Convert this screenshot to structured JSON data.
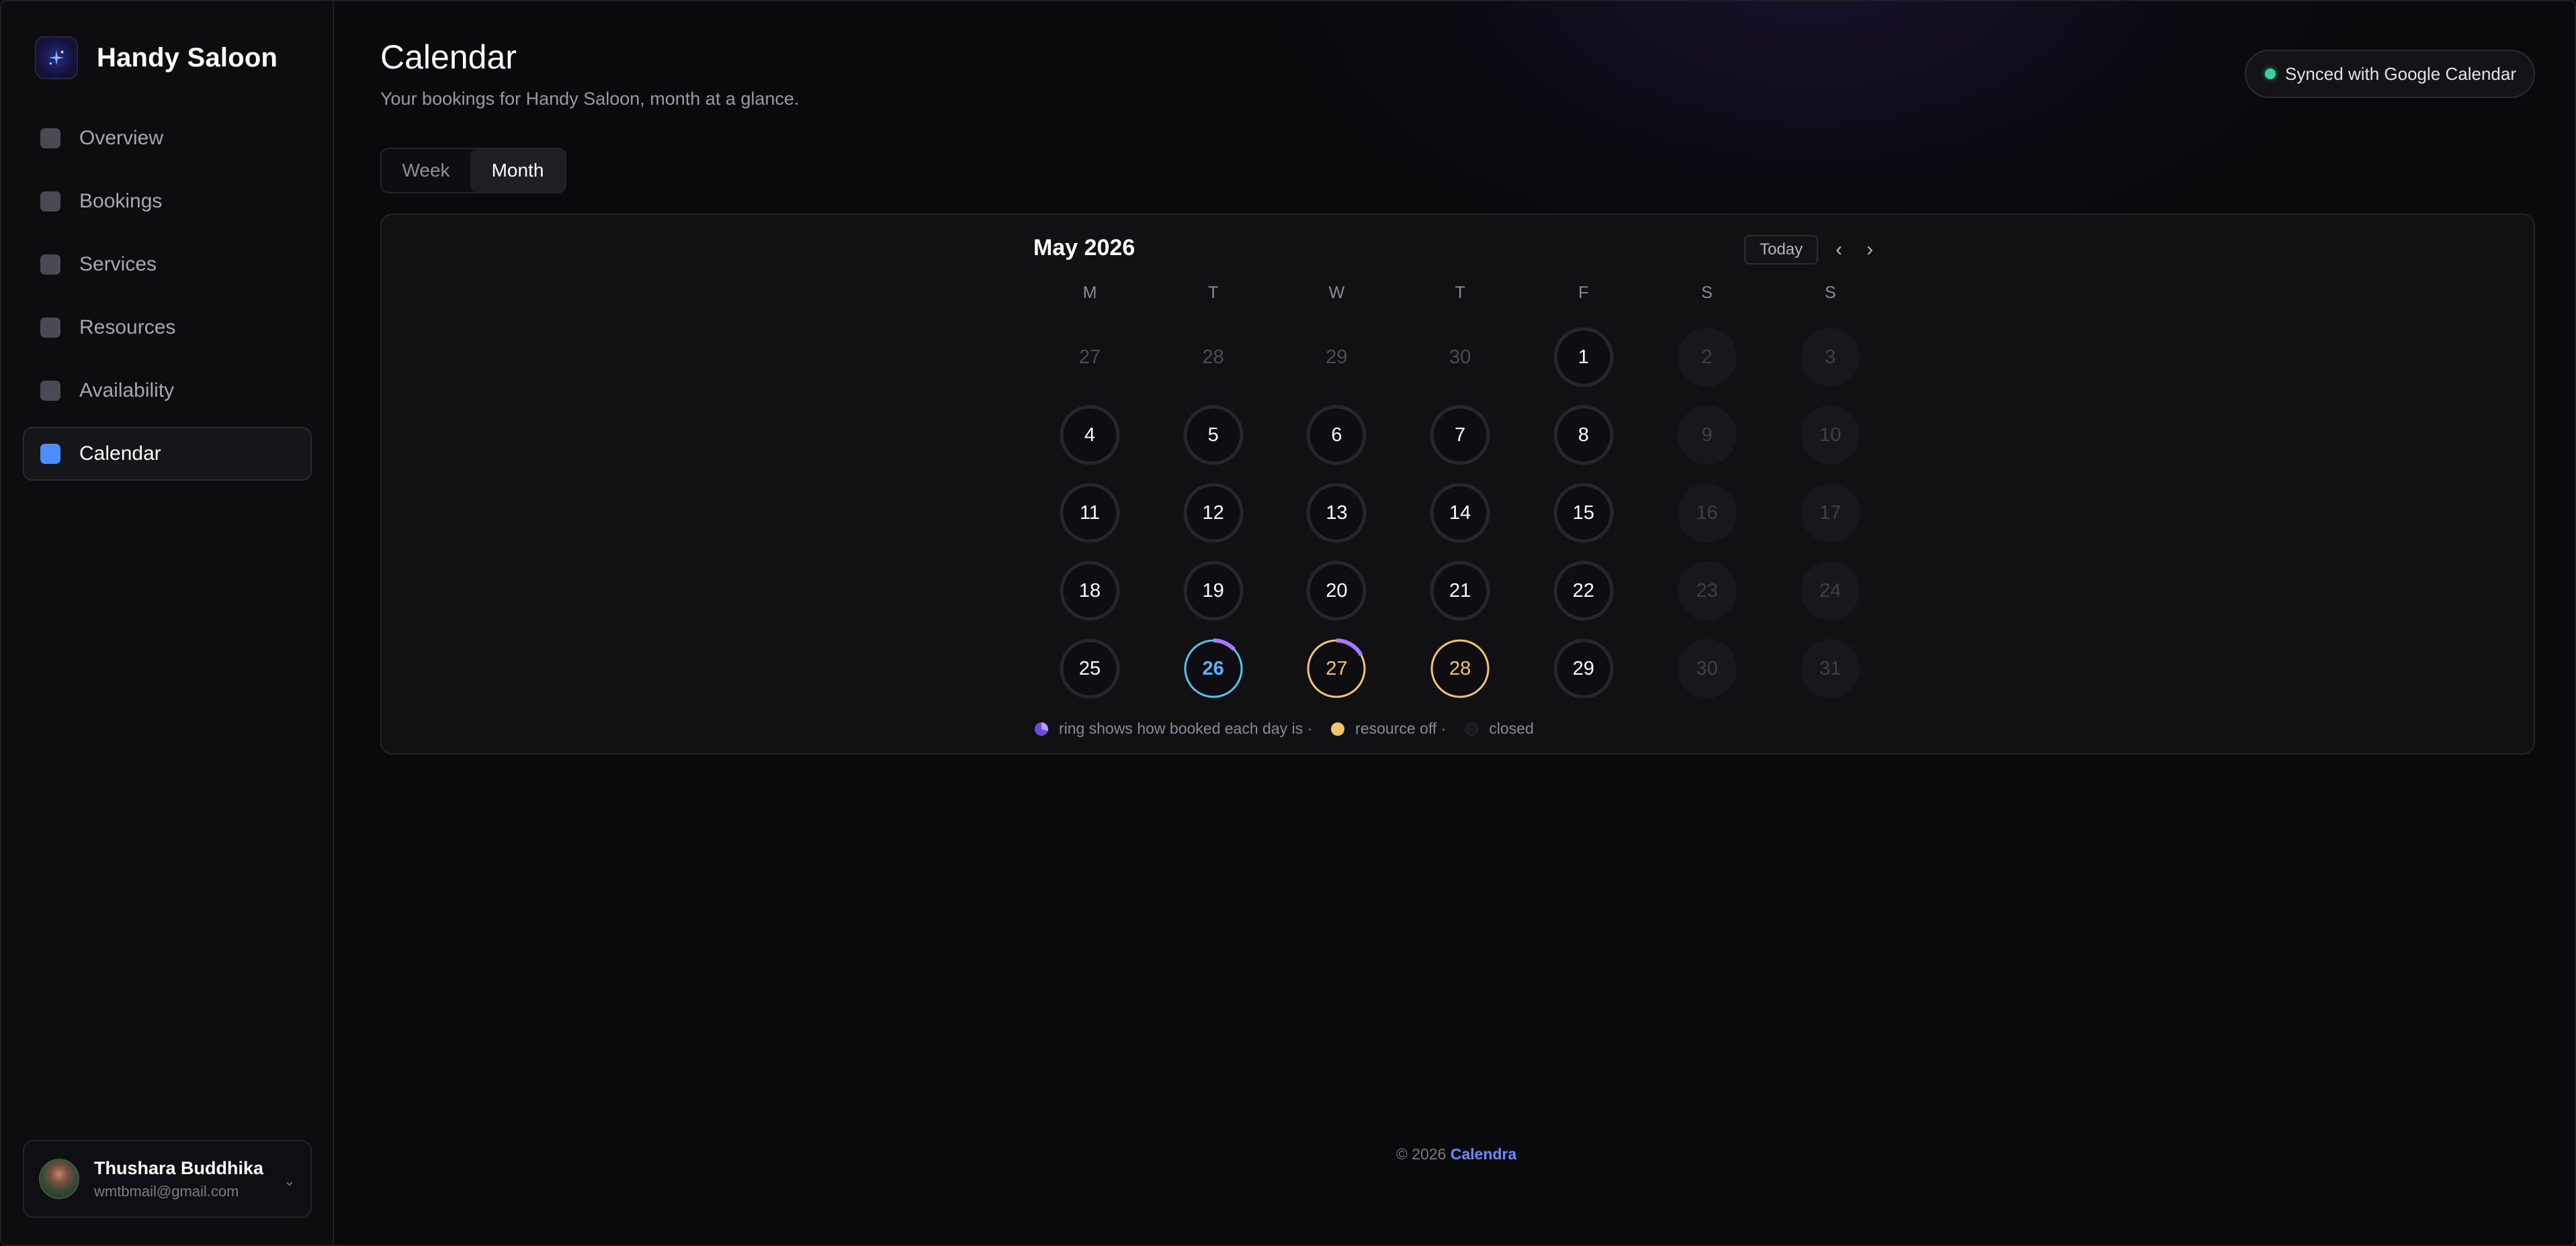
{
  "app": {
    "brand_name": "Handy Saloon",
    "accent": "#4b8dff"
  },
  "sidebar": {
    "items": [
      {
        "label": "Overview",
        "icon": "square-icon",
        "active": false
      },
      {
        "label": "Bookings",
        "icon": "square-icon",
        "active": false
      },
      {
        "label": "Services",
        "icon": "square-icon",
        "active": false
      },
      {
        "label": "Resources",
        "icon": "square-icon",
        "active": false
      },
      {
        "label": "Availability",
        "icon": "square-icon",
        "active": false
      },
      {
        "label": "Calendar",
        "icon": "square-icon",
        "active": true
      }
    ],
    "user": {
      "name": "Thushara Buddhika",
      "email": "wmtbmail@gmail.com"
    }
  },
  "header": {
    "title": "Calendar",
    "subtitle": "Your bookings for Handy Saloon, month at a glance.",
    "sync_label": "Synced with Google Calendar",
    "sync_color": "#34d399"
  },
  "view_toggle": {
    "options": [
      "Week",
      "Month"
    ],
    "selected": "Month"
  },
  "calendar": {
    "month_label": "May 2026",
    "today_label": "Today",
    "prev_symbol": "‹",
    "next_symbol": "›",
    "weekdays": [
      "M",
      "T",
      "W",
      "T",
      "F",
      "S",
      "S"
    ],
    "weeks": [
      [
        {
          "day": "27",
          "state": "outside",
          "booked": 0
        },
        {
          "day": "28",
          "state": "outside",
          "booked": 0
        },
        {
          "day": "29",
          "state": "outside",
          "booked": 0
        },
        {
          "day": "30",
          "state": "outside",
          "booked": 0
        },
        {
          "day": "1",
          "state": "open",
          "booked": 0
        },
        {
          "day": "2",
          "state": "closed",
          "booked": 0
        },
        {
          "day": "3",
          "state": "closed",
          "booked": 0
        }
      ],
      [
        {
          "day": "4",
          "state": "open",
          "booked": 0
        },
        {
          "day": "5",
          "state": "open",
          "booked": 0
        },
        {
          "day": "6",
          "state": "open",
          "booked": 0
        },
        {
          "day": "7",
          "state": "open",
          "booked": 0
        },
        {
          "day": "8",
          "state": "open",
          "booked": 0
        },
        {
          "day": "9",
          "state": "closed",
          "booked": 0
        },
        {
          "day": "10",
          "state": "closed",
          "booked": 0
        }
      ],
      [
        {
          "day": "11",
          "state": "open",
          "booked": 0
        },
        {
          "day": "12",
          "state": "open",
          "booked": 0
        },
        {
          "day": "13",
          "state": "open",
          "booked": 0
        },
        {
          "day": "14",
          "state": "open",
          "booked": 0
        },
        {
          "day": "15",
          "state": "open",
          "booked": 0
        },
        {
          "day": "16",
          "state": "closed",
          "booked": 0
        },
        {
          "day": "17",
          "state": "closed",
          "booked": 0
        }
      ],
      [
        {
          "day": "18",
          "state": "open",
          "booked": 0
        },
        {
          "day": "19",
          "state": "open",
          "booked": 0
        },
        {
          "day": "20",
          "state": "open",
          "booked": 0
        },
        {
          "day": "21",
          "state": "open",
          "booked": 0
        },
        {
          "day": "22",
          "state": "open",
          "booked": 0
        },
        {
          "day": "23",
          "state": "closed",
          "booked": 0
        },
        {
          "day": "24",
          "state": "closed",
          "booked": 0
        }
      ],
      [
        {
          "day": "25",
          "state": "open",
          "booked": 0
        },
        {
          "day": "26",
          "state": "today",
          "booked": 0.13
        },
        {
          "day": "27",
          "state": "off",
          "booked": 0.17
        },
        {
          "day": "28",
          "state": "off",
          "booked": 0
        },
        {
          "day": "29",
          "state": "open",
          "booked": 0
        },
        {
          "day": "30",
          "state": "closed",
          "booked": 0
        },
        {
          "day": "31",
          "state": "closed",
          "booked": 0
        }
      ]
    ],
    "colors": {
      "booked_ring": "#a878ff",
      "today_ring": "#4fc8e8",
      "resource_off": "#f2c56b",
      "open_ring": "#26262d",
      "closed_fill": "#17171c"
    },
    "legend": {
      "ring_text": "ring shows how booked each day is ·",
      "off_text": "resource off ·",
      "closed_text": "closed"
    }
  },
  "footer": {
    "copyright": "© 2026",
    "brand": "Calendra"
  }
}
